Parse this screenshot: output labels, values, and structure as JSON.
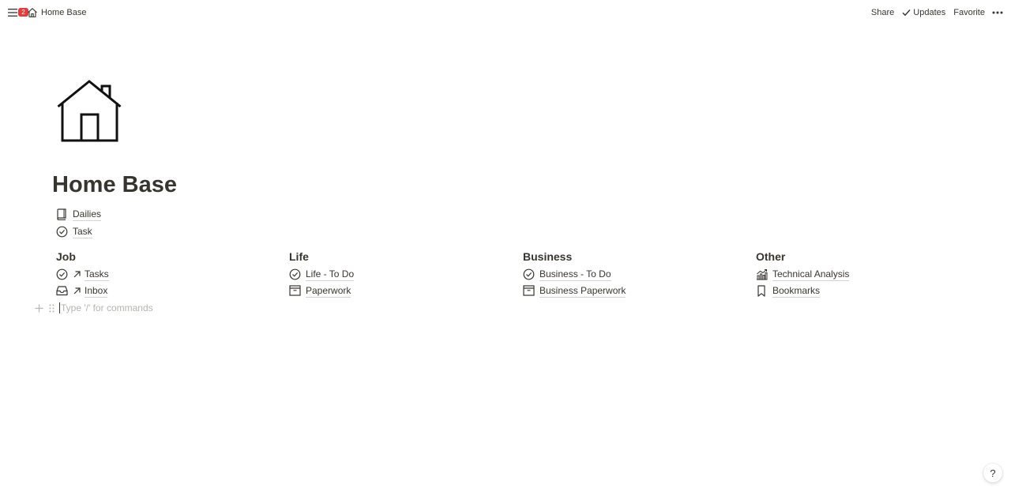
{
  "topbar": {
    "notification_count": "2",
    "breadcrumb_title": "Home Base",
    "share_label": "Share",
    "updates_label": "Updates",
    "favorite_label": "Favorite"
  },
  "page": {
    "title": "Home Base",
    "top_links": [
      {
        "label": "Dailies",
        "icon": "book-icon"
      },
      {
        "label": "Task",
        "icon": "check-circle-icon"
      }
    ],
    "columns": [
      {
        "title": "Job",
        "items": [
          {
            "label": "Tasks",
            "icon": "check-circle-icon",
            "linked": true
          },
          {
            "label": "Inbox",
            "icon": "inbox-icon",
            "linked": true
          }
        ]
      },
      {
        "title": "Life",
        "items": [
          {
            "label": "Life - To Do",
            "icon": "check-circle-icon"
          },
          {
            "label": "Paperwork",
            "icon": "archive-box-icon"
          }
        ]
      },
      {
        "title": "Business",
        "items": [
          {
            "label": "Business - To Do",
            "icon": "check-circle-icon"
          },
          {
            "label": "Business Paperwork",
            "icon": "archive-box-icon"
          }
        ]
      },
      {
        "title": "Other",
        "items": [
          {
            "label": "Technical Analysis",
            "icon": "chart-icon"
          },
          {
            "label": "Bookmarks",
            "icon": "bookmark-icon"
          }
        ]
      }
    ],
    "command_placeholder": "Type '/' for commands"
  },
  "help_label": "?"
}
